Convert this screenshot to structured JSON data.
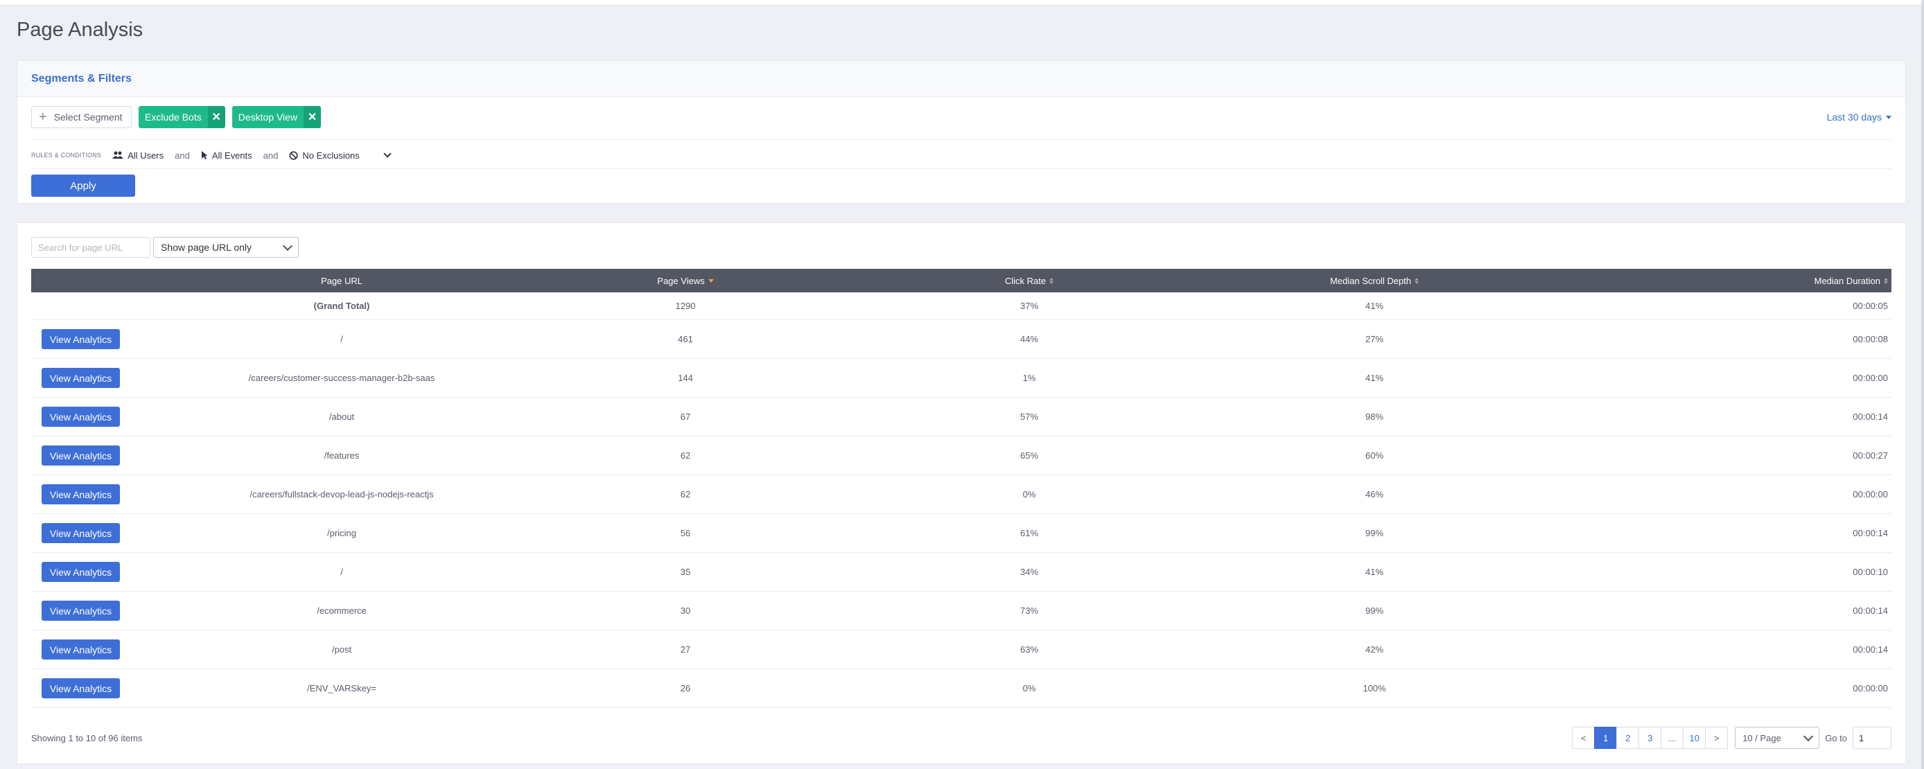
{
  "page": {
    "title": "Page Analysis"
  },
  "segments": {
    "title": "Segments & Filters",
    "select_segment_label": "Select Segment",
    "chips": [
      {
        "label": "Exclude Bots",
        "remove": "✕"
      },
      {
        "label": "Desktop View",
        "remove": "✕"
      }
    ],
    "date_range": "Last 30 days",
    "rules_label": "RULES & CONDITIONS",
    "conditions": {
      "users": "All Users",
      "and1": "and",
      "events": "All Events",
      "and2": "and",
      "exclusions": "No Exclusions"
    },
    "apply_label": "Apply"
  },
  "table": {
    "search_placeholder": "Search for page URL",
    "url_filter": "Show page URL only",
    "columns": {
      "page_url": "Page URL",
      "page_views": "Page Views",
      "click_rate": "Click Rate",
      "scroll_depth": "Median Scroll Depth",
      "duration": "Median Duration"
    },
    "total": {
      "url": "(Grand Total)",
      "views": "1290",
      "click_rate": "37%",
      "scroll": "41%",
      "duration": "00:00:05"
    },
    "view_button_label": "View Analytics",
    "rows": [
      {
        "url": "/",
        "views": "461",
        "click_rate": "44%",
        "scroll": "27%",
        "duration": "00:00:08"
      },
      {
        "url": "/careers/customer-success-manager-b2b-saas",
        "views": "144",
        "click_rate": "1%",
        "scroll": "41%",
        "duration": "00:00:00"
      },
      {
        "url": "/about",
        "views": "67",
        "click_rate": "57%",
        "scroll": "98%",
        "duration": "00:00:14"
      },
      {
        "url": "/features",
        "views": "62",
        "click_rate": "65%",
        "scroll": "60%",
        "duration": "00:00:27"
      },
      {
        "url": "/careers/fullstack-devop-lead-js-nodejs-reactjs",
        "views": "62",
        "click_rate": "0%",
        "scroll": "46%",
        "duration": "00:00:00"
      },
      {
        "url": "/pricing",
        "views": "56",
        "click_rate": "61%",
        "scroll": "99%",
        "duration": "00:00:14"
      },
      {
        "url": "/",
        "views": "35",
        "click_rate": "34%",
        "scroll": "41%",
        "duration": "00:00:10"
      },
      {
        "url": "/ecommerce",
        "views": "30",
        "click_rate": "73%",
        "scroll": "99%",
        "duration": "00:00:14"
      },
      {
        "url": "/post",
        "views": "27",
        "click_rate": "63%",
        "scroll": "42%",
        "duration": "00:00:14"
      },
      {
        "url": "/ENV_VARSkey=",
        "views": "26",
        "click_rate": "0%",
        "scroll": "100%",
        "duration": "00:00:00"
      }
    ],
    "footer": {
      "showing": "Showing 1 to 10 of 96 items",
      "prev": "<",
      "pages": [
        "1",
        "2",
        "3",
        "...",
        "10"
      ],
      "next": ">",
      "per_page": "10 / Page",
      "goto_label": "Go to",
      "goto_value": "1"
    }
  },
  "colors": {
    "accent": "#3e6ed7",
    "chip": "#1fba8b",
    "header_bg": "#535763",
    "sort_active": "#f0a23b"
  }
}
